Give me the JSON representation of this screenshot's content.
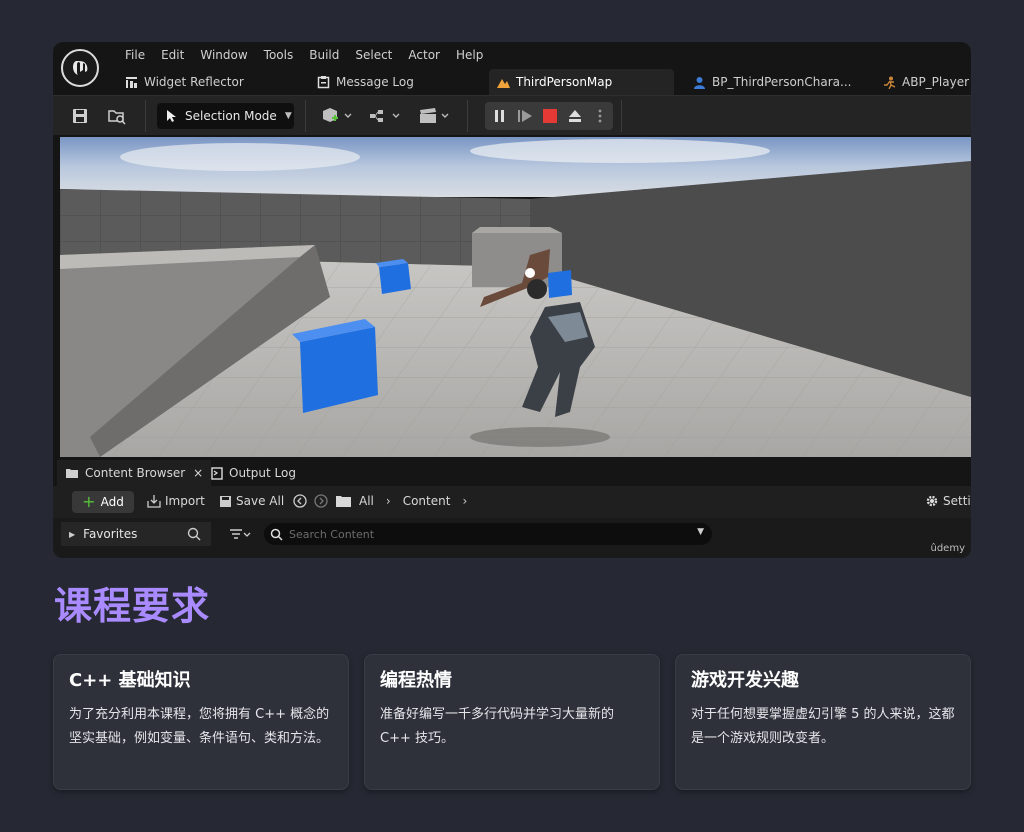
{
  "editor": {
    "menu": [
      "File",
      "Edit",
      "Window",
      "Tools",
      "Build",
      "Select",
      "Actor",
      "Help"
    ],
    "tabs": [
      {
        "label": "Widget Reflector",
        "icon": "widget-reflector-icon"
      },
      {
        "label": "Message Log",
        "icon": "message-log-icon"
      },
      {
        "label": "ThirdPersonMap",
        "icon": "level-map-icon",
        "active": true
      },
      {
        "label": "BP_ThirdPersonChara...",
        "icon": "character-blueprint-icon"
      },
      {
        "label": "ABP_Player",
        "icon": "anim-blueprint-icon"
      }
    ],
    "toolbar": {
      "selection_mode": "Selection Mode"
    },
    "content_browser": {
      "tabs": [
        "Content Browser",
        "Output Log"
      ],
      "close_glyph": "×",
      "add_label": "Add",
      "import_label": "Import",
      "save_all_label": "Save All",
      "path": [
        "All",
        "Content"
      ],
      "settings_label": "Setti",
      "favorites_label": "Favorites",
      "search_placeholder": "Search Content"
    },
    "watermark": "ûdemy",
    "colors": {
      "accent_red": "#e53935",
      "play_blue": "#1f6fe0",
      "add_green": "#57c23a"
    }
  },
  "section": {
    "title": "课程要求",
    "title_color": "#a98bff"
  },
  "cards": [
    {
      "title": "C++ 基础知识",
      "body": "为了充分利用本课程，您将拥有 C++ 概念的坚实基础，例如变量、条件语句、类和方法。"
    },
    {
      "title": "编程热情",
      "body": "准备好编写一千多行代码并学习大量新的 C++ 技巧。"
    },
    {
      "title": "游戏开发兴趣",
      "body": "对于任何想要掌握虚幻引擎 5 的人来说，这都是一个游戏规则改变者。"
    }
  ]
}
